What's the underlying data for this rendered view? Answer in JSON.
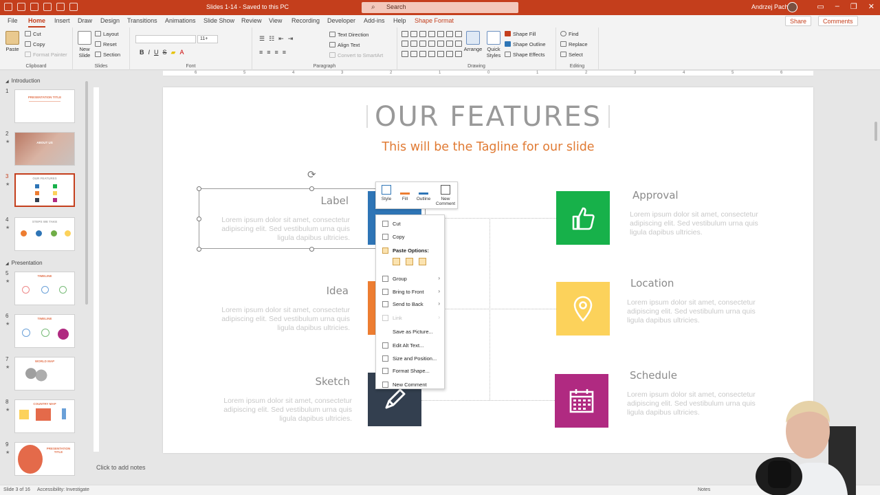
{
  "titlebar": {
    "doc_title": "Slides 1-14  -  Saved to this PC",
    "search_placeholder": "Search",
    "user_name": "Andrzej Pach"
  },
  "menu": {
    "tabs": [
      "File",
      "Home",
      "Insert",
      "Draw",
      "Design",
      "Transitions",
      "Animations",
      "Slide Show",
      "Review",
      "View",
      "Recording",
      "Developer",
      "Add-ins",
      "Help",
      "Shape Format"
    ],
    "active": "Home",
    "share": "Share",
    "comments": "Comments"
  },
  "ribbon": {
    "clipboard": {
      "label": "Clipboard",
      "paste": "Paste",
      "cut": "Cut",
      "copy": "Copy",
      "format_painter": "Format Painter"
    },
    "slides": {
      "label": "Slides",
      "new_slide": "New Slide",
      "layout": "Layout",
      "reset": "Reset",
      "section": "Section"
    },
    "font": {
      "label": "Font",
      "size": "11+",
      "bold": "B",
      "italic": "I",
      "underline": "U",
      "strike": "S"
    },
    "paragraph": {
      "label": "Paragraph",
      "text_direction": "Text Direction",
      "align_text": "Align Text",
      "convert_smartart": "Convert to SmartArt"
    },
    "drawing": {
      "label": "Drawing",
      "arrange": "Arrange",
      "quick_styles": "Quick Styles",
      "shape_fill": "Shape Fill",
      "shape_outline": "Shape Outline",
      "shape_effects": "Shape Effects"
    },
    "editing": {
      "label": "Editing",
      "find": "Find",
      "replace": "Replace",
      "select": "Select"
    }
  },
  "ruler_ticks": [
    "6",
    "5",
    "4",
    "3",
    "2",
    "1",
    "0",
    "1",
    "2",
    "3",
    "4",
    "5",
    "6"
  ],
  "thumbnails": {
    "sections": [
      "Introduction",
      "Presentation"
    ],
    "slides": [
      {
        "num": "1",
        "title": "PRESENTATION TITLE"
      },
      {
        "num": "2",
        "title": "ABOUT US"
      },
      {
        "num": "3",
        "title": "OUR FEATURES"
      },
      {
        "num": "4",
        "title": "STEPS WE TAKE"
      },
      {
        "num": "5",
        "title": "TIMELINE"
      },
      {
        "num": "6",
        "title": "TIMELINE"
      },
      {
        "num": "7",
        "title": "WORLD MAP"
      },
      {
        "num": "8",
        "title": "COUNTRY MAP"
      },
      {
        "num": "9",
        "title": "PRESENTATION TITLE"
      }
    ]
  },
  "slide": {
    "title": "OUR FEATURES",
    "tagline": "This will be the Tagline for our slide",
    "left": [
      {
        "label": "Label",
        "text": "Lorem ipsum dolor sit amet, consectetur adipiscing elit. Sed vestibulum urna quis ligula dapibus ultricies.",
        "color": "#2e75b6"
      },
      {
        "label": "Idea",
        "text": "Lorem ipsum dolor sit amet, consectetur adipiscing elit. Sed vestibulum urna quis ligula dapibus ultricies.",
        "color": "#ed7d31"
      },
      {
        "label": "Sketch",
        "text": "Lorem ipsum dolor sit amet, consectetur adipiscing elit. Sed vestibulum urna quis ligula dapibus ultricies.",
        "color": "#333f4f"
      }
    ],
    "right": [
      {
        "label": "Approval",
        "text": "Lorem ipsum dolor sit amet, consectetur adipiscing elit. Sed vestibulum urna quis ligula dapibus ultricies.",
        "color": "#17b14a"
      },
      {
        "label": "Location",
        "text": "Lorem ipsum dolor sit amet, consectetur adipiscing elit. Sed vestibulum urna quis ligula dapibus ultricies.",
        "color": "#fcd25b"
      },
      {
        "label": "Schedule",
        "text": "Lorem ipsum dolor sit amet, consectetur adipiscing elit. Sed vestibulum urna quis ligula dapibus ultricies.",
        "color": "#b02a81"
      }
    ]
  },
  "mini_toolbar": {
    "style": "Style",
    "fill": "Fill",
    "outline": "Outline",
    "new_comment": "New Comment"
  },
  "context_menu": {
    "cut": "Cut",
    "copy": "Copy",
    "paste_options": "Paste Options:",
    "group": "Group",
    "bring_to_front": "Bring to Front",
    "send_to_back": "Send to Back",
    "link": "Link",
    "save_as_picture": "Save as Picture...",
    "edit_alt_text": "Edit Alt Text...",
    "size_and_position": "Size and Position...",
    "format_shape": "Format Shape...",
    "new_comment": "New Comment"
  },
  "notes": {
    "placeholder": "Click to add notes"
  },
  "status": {
    "slide": "Slide 3 of 16",
    "accessibility": "Accessibility: Investigate",
    "notes_btn": "Notes"
  },
  "colors": {
    "accent": "#c43e1c",
    "tagline": "#e07a33"
  }
}
